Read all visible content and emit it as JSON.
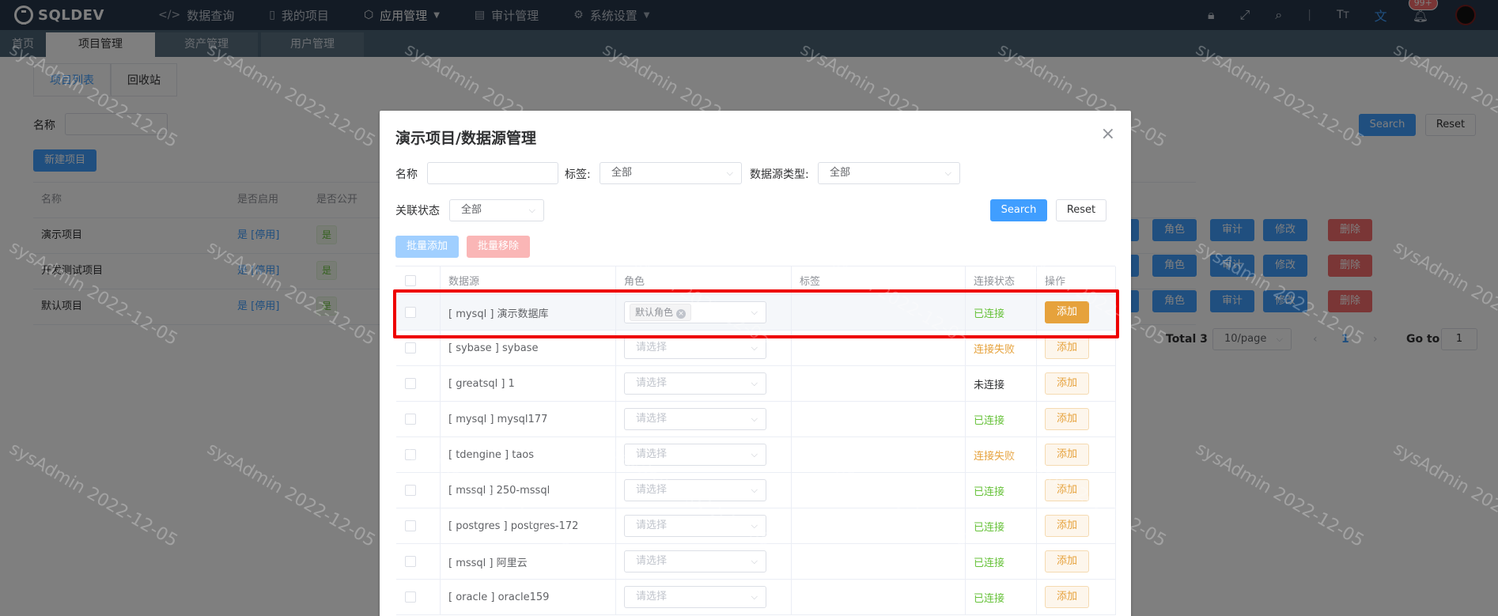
{
  "app": {
    "brand": "SQLDEV"
  },
  "nav": {
    "items": [
      {
        "label": "数据查询",
        "icon": "code-icon"
      },
      {
        "label": "我的项目",
        "icon": "book-icon"
      },
      {
        "label": "应用管理",
        "icon": "box-icon"
      },
      {
        "label": "审计管理",
        "icon": "audit-icon"
      },
      {
        "label": "系统设置",
        "icon": "gear-icon"
      }
    ],
    "badge": "99+"
  },
  "tabs": [
    "首页",
    "项目管理",
    "资产管理",
    "用户管理"
  ],
  "page": {
    "subtabs": [
      "项目列表",
      "回收站"
    ],
    "filter_label": "名称",
    "search_label": "Search",
    "reset_label": "Reset",
    "new_button": "新建项目",
    "columns": [
      "名称",
      "是否启用",
      "是否公开"
    ],
    "rows": [
      {
        "name": "演示项目",
        "enabled": "是 [停用]",
        "public": "是"
      },
      {
        "name": "开发测试项目",
        "enabled": "是 [停用]",
        "public": "是"
      },
      {
        "name": "默认项目",
        "enabled": "是 [停用]",
        "public": "是"
      }
    ],
    "row_actions": [
      "角色",
      "审计",
      "修改",
      "删除"
    ],
    "pagination": {
      "total": "Total 3",
      "page_size": "10/page",
      "current": "1",
      "goto_label": "Go to",
      "goto_value": "1"
    }
  },
  "watermark": "sysAdmin 2022-12-05",
  "dialog": {
    "title": "演示项目/数据源管理",
    "filters": {
      "name_label": "名称",
      "tag_label": "标签:",
      "tag_value": "全部",
      "type_label": "数据源类型:",
      "type_value": "全部",
      "link_label": "关联状态",
      "link_value": "全部"
    },
    "search_label": "Search",
    "reset_label": "Reset",
    "batch_add": "批量添加",
    "batch_remove": "批量移除",
    "columns": [
      "数据源",
      "角色",
      "标签",
      "连接状态",
      "操作"
    ],
    "role_placeholder": "请选择",
    "add_label": "添加",
    "rows": [
      {
        "source": "[ mysql ] 演示数据库",
        "role": "默认角色",
        "status": "已连接",
        "status_type": "ok"
      },
      {
        "source": "[ sybase ] sybase",
        "role": "",
        "status": "连接失败",
        "status_type": "fail"
      },
      {
        "source": "[ greatsql ] 1",
        "role": "",
        "status": "未连接",
        "status_type": "none"
      },
      {
        "source": "[ mysql ] mysql177",
        "role": "",
        "status": "已连接",
        "status_type": "ok"
      },
      {
        "source": "[ tdengine ] taos",
        "role": "",
        "status": "连接失败",
        "status_type": "fail"
      },
      {
        "source": "[ mssql ] 250-mssql",
        "role": "",
        "status": "已连接",
        "status_type": "ok"
      },
      {
        "source": "[ postgres ] postgres-172",
        "role": "",
        "status": "已连接",
        "status_type": "ok"
      },
      {
        "source": "[ mssql ] 阿里云",
        "role": "",
        "status": "已连接",
        "status_type": "ok"
      },
      {
        "source": "[ oracle ] oracle159",
        "role": "",
        "status": "已连接",
        "status_type": "ok"
      }
    ]
  }
}
